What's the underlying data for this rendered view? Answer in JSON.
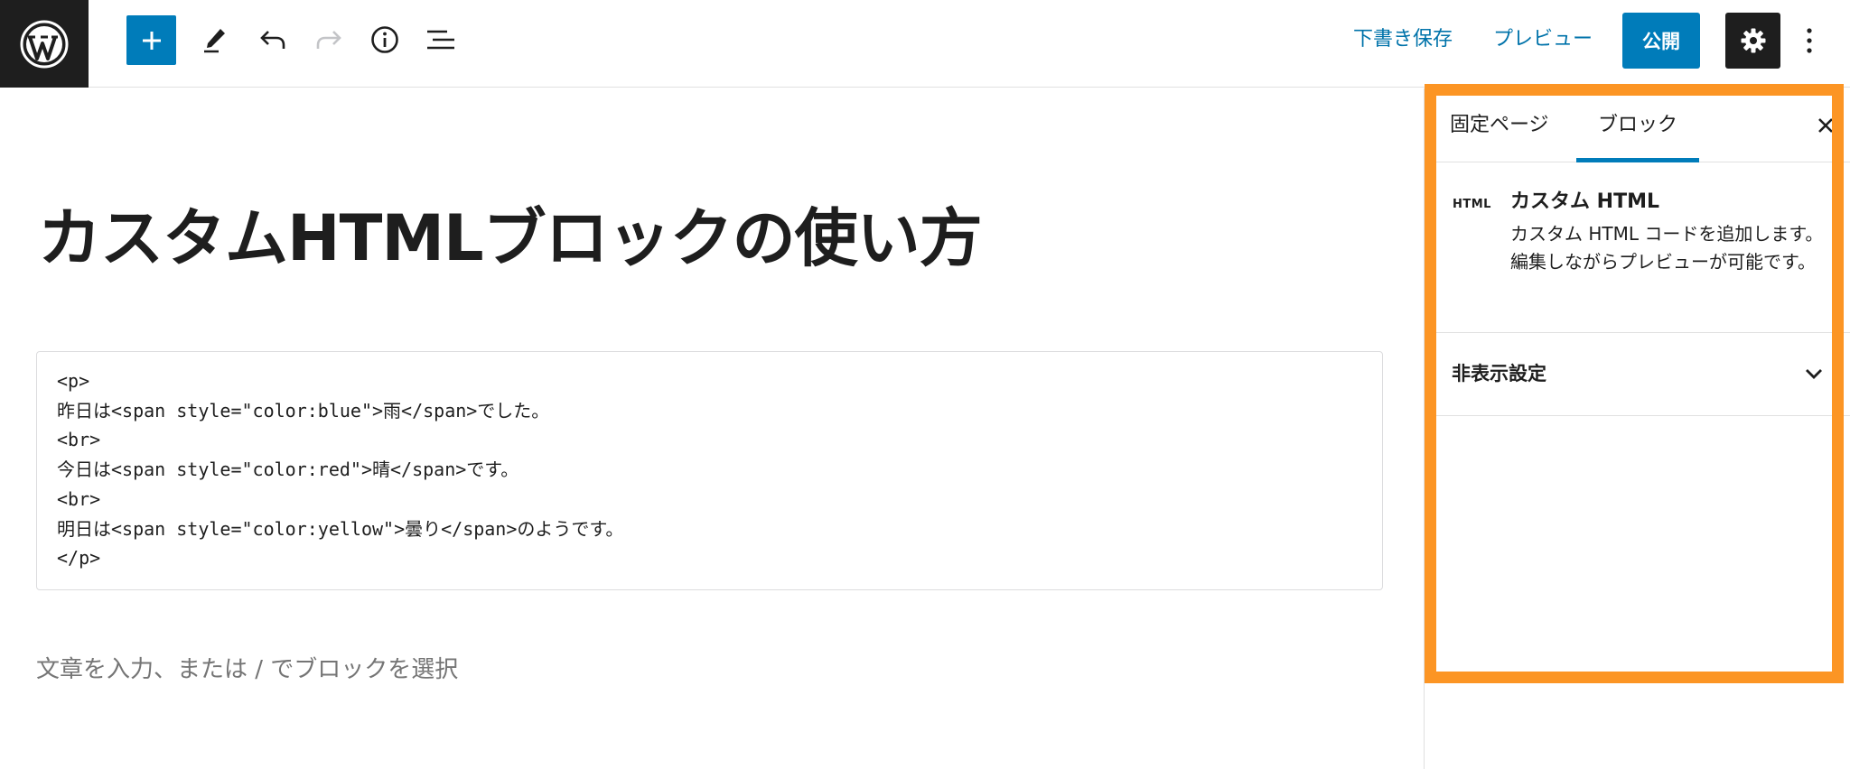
{
  "toolbar": {
    "logo": "wordpress-logo",
    "tools": [
      "add-block",
      "edit-pencil",
      "undo",
      "redo",
      "info",
      "list-view"
    ],
    "save_draft_label": "下書き保存",
    "preview_label": "プレビュー",
    "publish_label": "公開",
    "settings_icon": "gear-icon",
    "more_icon": "vertical-ellipsis-icon"
  },
  "editor": {
    "title": "カスタムHTMLブロックの使い方",
    "html_code_lines": [
      "<p>",
      "昨日は<span style=\"color:blue\">雨</span>でした。",
      "<br>",
      "今日は<span style=\"color:red\">晴</span>です。",
      "<br>",
      "明日は<span style=\"color:yellow\">曇り</span>のようです。",
      "</p>"
    ],
    "placeholder": "文章を入力、または / でブロックを選択"
  },
  "sidebar": {
    "tabs": [
      {
        "label": "固定ページ",
        "active": false
      },
      {
        "label": "ブロック",
        "active": true
      }
    ],
    "block": {
      "icon_label": "HTML",
      "name": "カスタム HTML",
      "description": "カスタム HTML コードを追加します。編集しながらプレビューが可能です。"
    },
    "panel": {
      "title": "非表示設定"
    }
  },
  "colors": {
    "accent": "#007cba",
    "link": "#0073aa",
    "dark": "#1e1e1e",
    "highlight": "#fc9524",
    "placeholder": "#757575"
  }
}
